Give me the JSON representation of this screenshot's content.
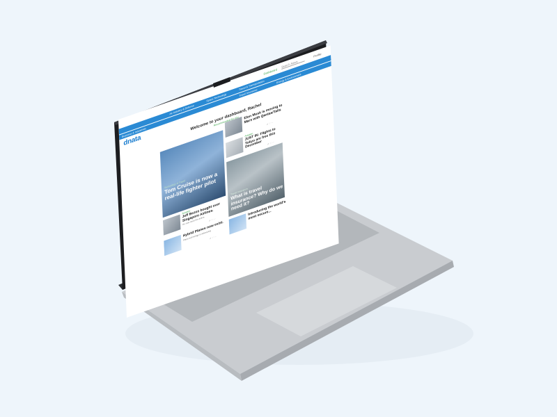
{
  "colors": {
    "brand": "#1e7fd0",
    "nav": "#2a8ad4",
    "accent_green": "#3aa44a",
    "background": "#eef5fb"
  },
  "topbar": {
    "dashboard": "Dashboard",
    "search": "Search News",
    "profile": "Profile"
  },
  "logo": "dnata",
  "nav_row1": [
    "Air Industry & Defense",
    "Space Technology",
    "Travel & Transportation"
  ],
  "nav_row2": [
    "Business & Industrials",
    "Travel Insurance",
    "Energy & Environment"
  ],
  "welcome": "Welcome to your dashboard, Rachel",
  "recommended": "Recommended for you",
  "articles": {
    "hero": {
      "tag": "Technology & Travel",
      "title": "Tom Cruise is now a real-life fighter pilot"
    },
    "a1": {
      "sub": "Aviation",
      "title": "Elon Musk is moving to Mars with Qantas/Tails",
      "text": "Nope, not the Elon Musk you know"
    },
    "a2": {
      "sub": "Aviation",
      "title": "JUST IN: Flights to Tokyo are free this December",
      "text": "Nope, free flights"
    },
    "a3": {
      "sub": "Aviation",
      "title": "Jeff Bezos bought over Singapore Airlines.",
      "text": "He now owns the airline"
    },
    "big": {
      "tag": "Travel Insurance",
      "title": "What is travel insurance? Why do we need it?"
    },
    "a4": {
      "sub": "Aviation",
      "title": "Hybrid Planes now exist.",
      "text": "Plane technology is advancing"
    },
    "a5": {
      "sub": "Aviation",
      "title": "Introducing the world's most secure...",
      "text": "Security is now better"
    }
  }
}
